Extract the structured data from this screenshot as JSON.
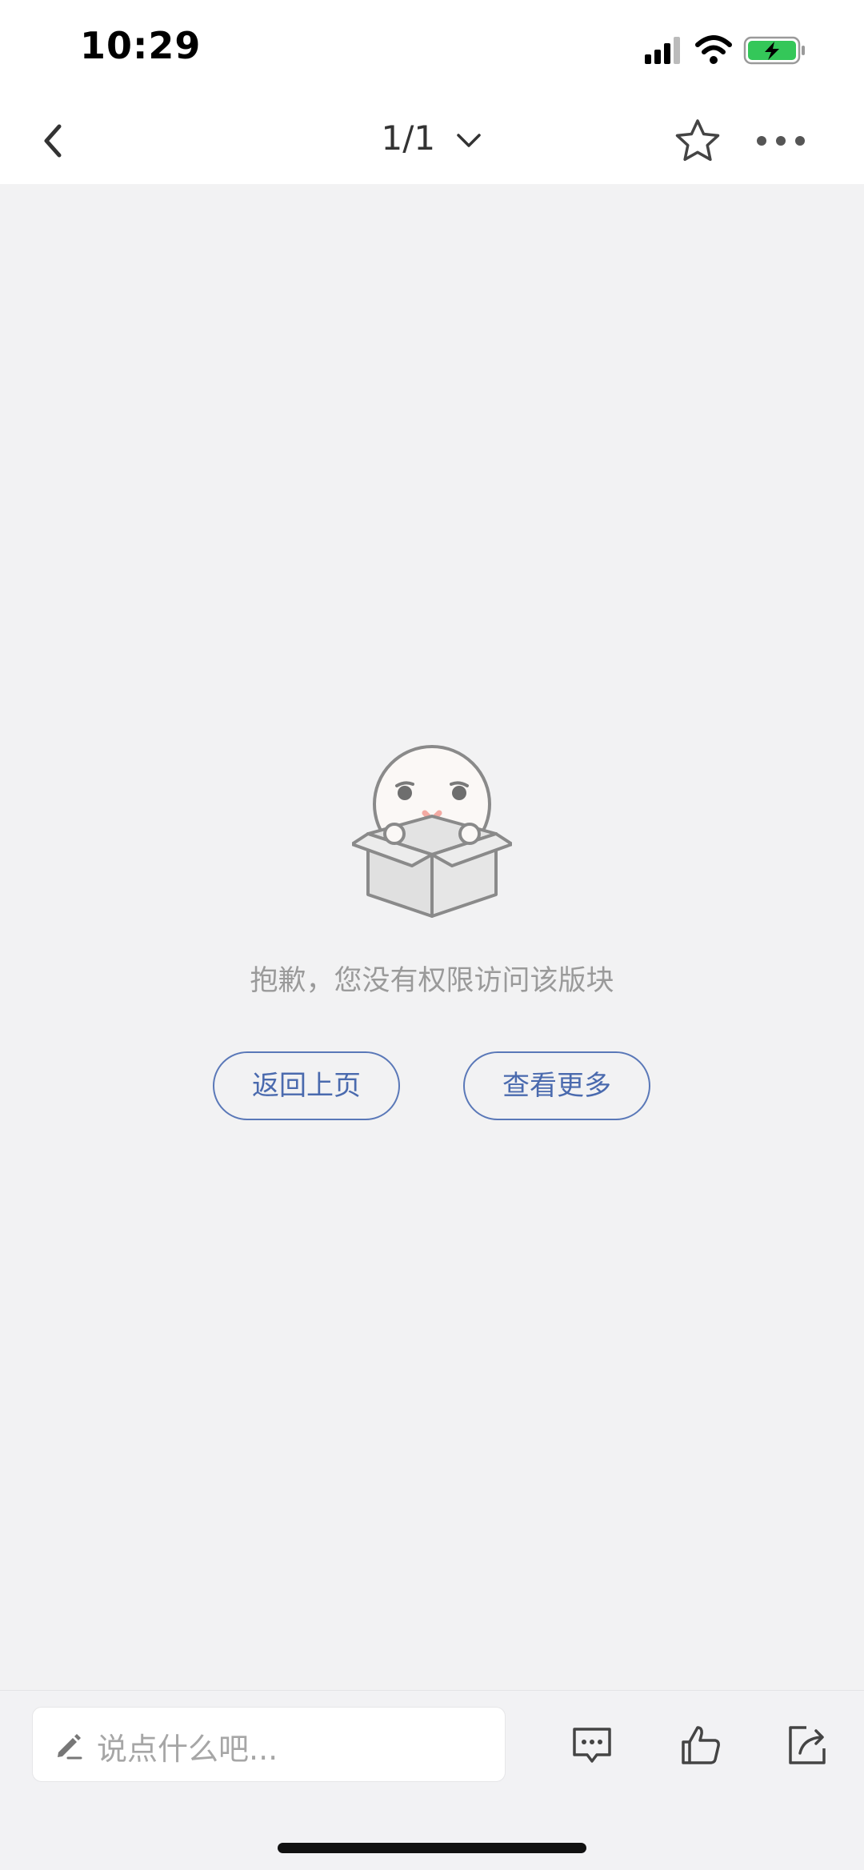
{
  "status_bar": {
    "time": "10:29",
    "icons": [
      "signal-icon",
      "wifi-icon",
      "battery-charging-icon"
    ],
    "battery_color": "#34c759"
  },
  "nav": {
    "back_icon": "chevron-left-icon",
    "pager": "1/1",
    "pager_icon": "chevron-down-icon",
    "favorite_icon": "star-icon",
    "more_icon": "more-dots-icon"
  },
  "empty_state": {
    "illustration": "character-in-box-illustration",
    "message": "抱歉，您没有权限访问该版块",
    "back_button": "返回上页",
    "more_button": "查看更多",
    "accent_color": "#4a6aae"
  },
  "bottom_bar": {
    "comment_placeholder": "说点什么吧...",
    "pen_icon": "pen-icon",
    "comment_icon": "comment-icon",
    "like_icon": "thumbs-up-icon",
    "share_icon": "share-icon"
  }
}
